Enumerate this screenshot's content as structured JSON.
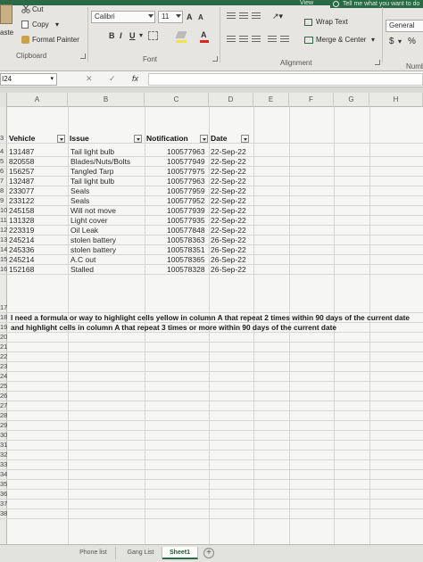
{
  "ribbon": {
    "view_tab": "View",
    "tell_me": "Tell me what you want to do",
    "clipboard": {
      "paste_label": "aste",
      "cut_label": "Cut",
      "copy_label": "Copy",
      "format_painter_label": "Format Painter",
      "group_label": "Clipboard"
    },
    "font": {
      "font_name": "Calibri",
      "font_size": "11",
      "grow_label": "A",
      "shrink_label": "A",
      "bold_label": "B",
      "italic_label": "I",
      "underline_label": "U",
      "font_color_label": "A",
      "group_label": "Font"
    },
    "alignment": {
      "wrap_text_label": "Wrap Text",
      "merge_center_label": "Merge & Center",
      "group_label": "Alignment"
    },
    "number": {
      "format_value": "General",
      "currency_label": "$",
      "percent_label": "%",
      "group_label": "Numb"
    }
  },
  "formula_bar": {
    "name_box_value": "I24",
    "cancel_label": "✕",
    "enter_label": "✓",
    "fx_label": "fx",
    "formula_value": ""
  },
  "columns": [
    "A",
    "B",
    "C",
    "D",
    "E",
    "F",
    "G",
    "H"
  ],
  "table": {
    "headers": [
      "Vehicle",
      "Issue",
      "Notification",
      "Date"
    ],
    "rows": [
      {
        "num": "4",
        "vehicle": "131487",
        "issue": "Tail light bulb",
        "notification": "100577963",
        "date": "22-Sep-22"
      },
      {
        "num": "5",
        "vehicle": "820558",
        "issue": "Blades/Nuts/Bolts",
        "notification": "100577949",
        "date": "22-Sep-22"
      },
      {
        "num": "6",
        "vehicle": "156257",
        "issue": "Tangled Tarp",
        "notification": "100577975",
        "date": "22-Sep-22"
      },
      {
        "num": "7",
        "vehicle": "132487",
        "issue": "Tail light bulb",
        "notification": "100577963",
        "date": "22-Sep-22"
      },
      {
        "num": "8",
        "vehicle": "233077",
        "issue": "Seals",
        "notification": "100577959",
        "date": "22-Sep-22"
      },
      {
        "num": "9",
        "vehicle": "233122",
        "issue": "Seals",
        "notification": "100577952",
        "date": "22-Sep-22"
      },
      {
        "num": "10",
        "vehicle": "245158",
        "issue": "Will not move",
        "notification": "100577939",
        "date": "22-Sep-22"
      },
      {
        "num": "11",
        "vehicle": "131328",
        "issue": "Light cover",
        "notification": "100577935",
        "date": "22-Sep-22"
      },
      {
        "num": "12",
        "vehicle": "223319",
        "issue": "Oil Leak",
        "notification": "100577848",
        "date": "22-Sep-22"
      },
      {
        "num": "13",
        "vehicle": "245214",
        "issue": "stolen battery",
        "notification": "100578363",
        "date": "26-Sep-22"
      },
      {
        "num": "14",
        "vehicle": "245336",
        "issue": "stolen battery",
        "notification": "100578351",
        "date": "26-Sep-22"
      },
      {
        "num": "15",
        "vehicle": "245214",
        "issue": "A.C out",
        "notification": "100578365",
        "date": "26-Sep-22"
      },
      {
        "num": "16",
        "vehicle": "152168",
        "issue": "Stalled",
        "notification": "100578328",
        "date": "26-Sep-22"
      }
    ]
  },
  "notes": {
    "row17": "17",
    "row18_num": "18",
    "row18_text": "I need a formula or way to highlight cells yellow in column A that repeat 2 times within 90 days of the current date",
    "row19_num": "19",
    "row19_text": "and highlight cells in column A that repeat 3 times or more within 90 days of the current date"
  },
  "empty_rows": [
    "20",
    "21",
    "22",
    "23",
    "24",
    "25",
    "26",
    "27",
    "28",
    "29",
    "30",
    "31",
    "32",
    "33",
    "34",
    "35",
    "36",
    "37",
    "38"
  ],
  "header_row_num": "3",
  "sheet_tabs": [
    {
      "label": "Phone list",
      "active": false
    },
    {
      "label": "Gang List",
      "active": false
    },
    {
      "label": "Sheet1",
      "active": true
    }
  ],
  "add_sheet_label": "+",
  "colors": {
    "excel_green": "#2a6a45",
    "ribbon_bg": "#e6e5e1",
    "grid_bg": "#f6f6f4"
  }
}
